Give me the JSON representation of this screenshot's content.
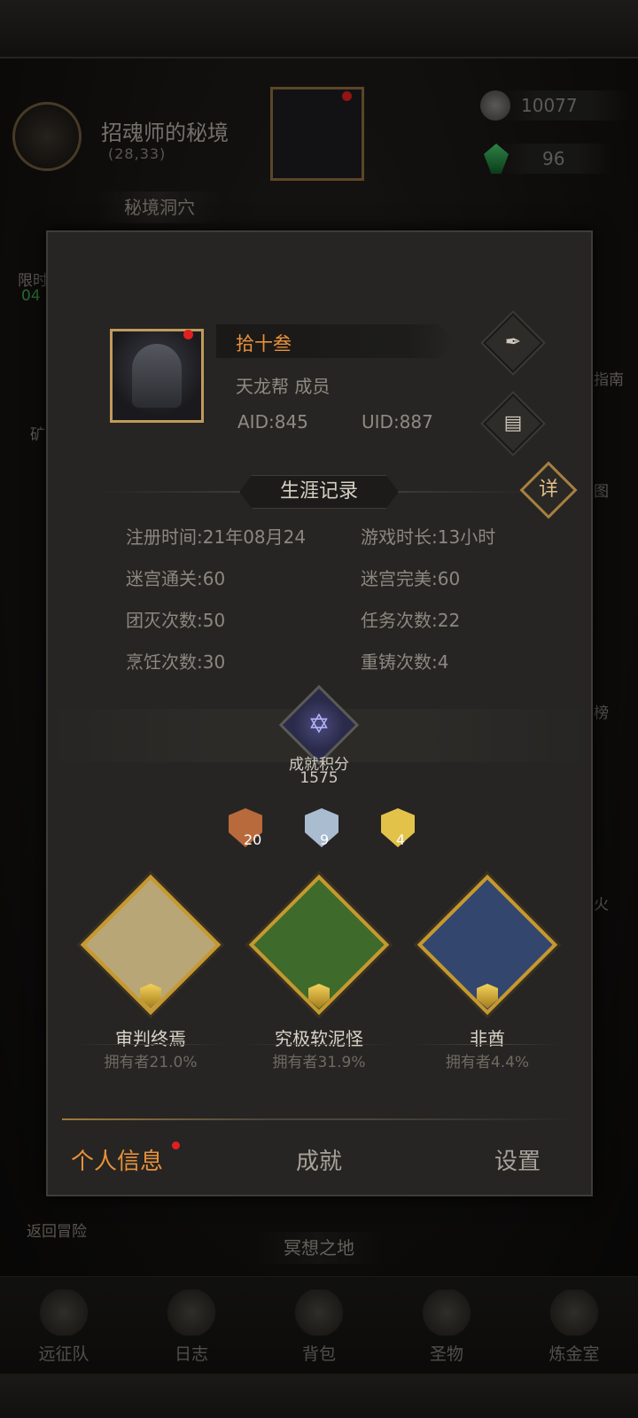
{
  "location": {
    "title": "招魂师的秘境",
    "coords": "(28,33)",
    "sublocation": "秘境洞穴"
  },
  "resources": [
    {
      "icon": "stone-icon",
      "value": "10077"
    },
    {
      "icon": "emerald-icon",
      "value": "96"
    }
  ],
  "left_side": {
    "limited_label": "限时",
    "limited_time": "04",
    "mine_label": "矿"
  },
  "right_side": {
    "guide_label": "指南",
    "map_label": "图",
    "rank_label": "榜",
    "fire_label": "火"
  },
  "profile": {
    "name": "拾十叁",
    "guild": "天龙帮 成员",
    "aid": "AID:845",
    "uid": "UID:887"
  },
  "career": {
    "title": "生涯记录",
    "detail_label": "详",
    "stats": [
      {
        "label": "注册时间:",
        "value": "21年08月24"
      },
      {
        "label": "游戏时长:",
        "value": "13小时"
      },
      {
        "label": "迷宫通关:",
        "value": "60"
      },
      {
        "label": "迷宫完美:",
        "value": "60"
      },
      {
        "label": "团灭次数:",
        "value": "50"
      },
      {
        "label": "任务次数:",
        "value": "22"
      },
      {
        "label": "烹饪次数:",
        "value": "30"
      },
      {
        "label": "重铸次数:",
        "value": "4"
      }
    ]
  },
  "achievement": {
    "label": "成就积分",
    "score": "1575",
    "medals": [
      {
        "tier": "bronze",
        "count": "20",
        "color": "#b86a3c"
      },
      {
        "tier": "silver",
        "count": "9",
        "color": "#a9bcd0"
      },
      {
        "tier": "gold",
        "count": "4",
        "color": "#e3c24a"
      }
    ],
    "cards": [
      {
        "name": "审判终焉",
        "owners": "拥有者21.0%",
        "bg": "#b9a676"
      },
      {
        "name": "究极软泥怪",
        "owners": "拥有者31.9%",
        "bg": "#3e6b2c"
      },
      {
        "name": "非酋",
        "owners": "拥有者4.4%",
        "bg": "#33466e"
      }
    ]
  },
  "tabs": [
    "个人信息",
    "成就",
    "设置"
  ],
  "back_label": "返回冒险",
  "meditate_label": "冥想之地",
  "bottom_nav": [
    "远征队",
    "日志",
    "背包",
    "圣物",
    "炼金室"
  ]
}
